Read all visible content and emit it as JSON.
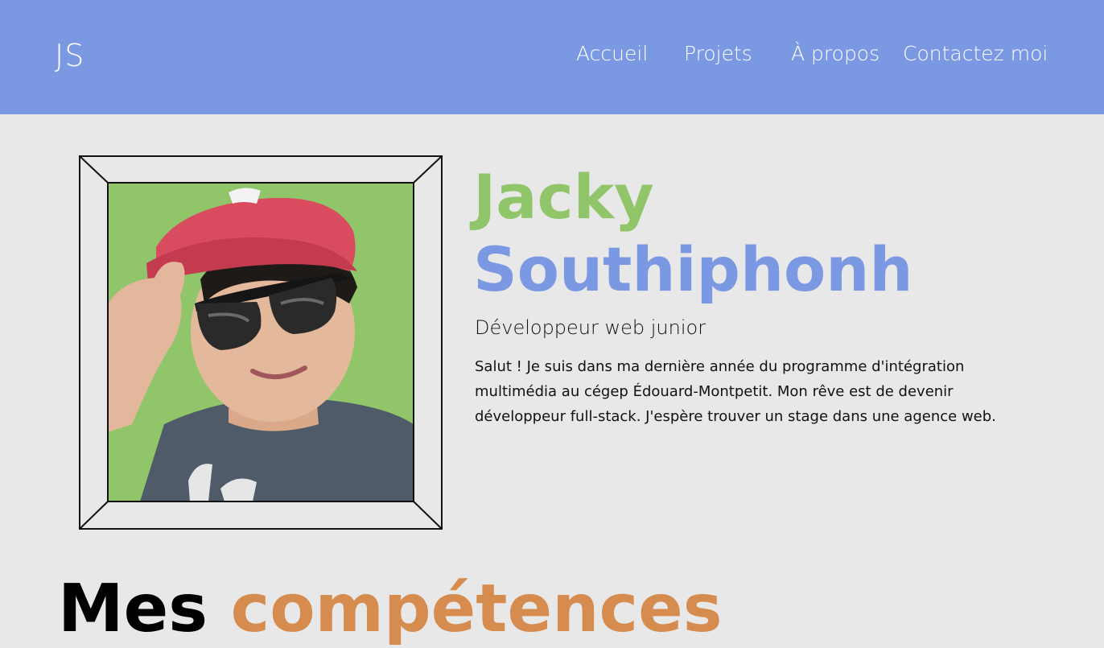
{
  "header": {
    "logo": "JS",
    "nav": [
      {
        "label": "Accueil"
      },
      {
        "label": "Projets"
      },
      {
        "label": "À propos"
      },
      {
        "label": "Contactez moi"
      }
    ]
  },
  "hero": {
    "first_name": "Jacky",
    "last_name": "Southiphonh",
    "job_title": "Développeur web junior",
    "bio": "Salut ! Je suis dans ma dernière année du programme d'intégration multimédia au cégep Édouard-Montpetit. Mon rêve est de devenir développeur full-stack. J'espère trouver un stage dans une agence web."
  },
  "skills": {
    "title_part1": "Mes",
    "title_part2": "compétences"
  },
  "colors": {
    "header_bg": "#7b99e2",
    "page_bg": "#e8e8e8",
    "green_accent": "#90c56a",
    "blue_accent": "#7b99e2",
    "orange_accent": "#d68c4f"
  }
}
